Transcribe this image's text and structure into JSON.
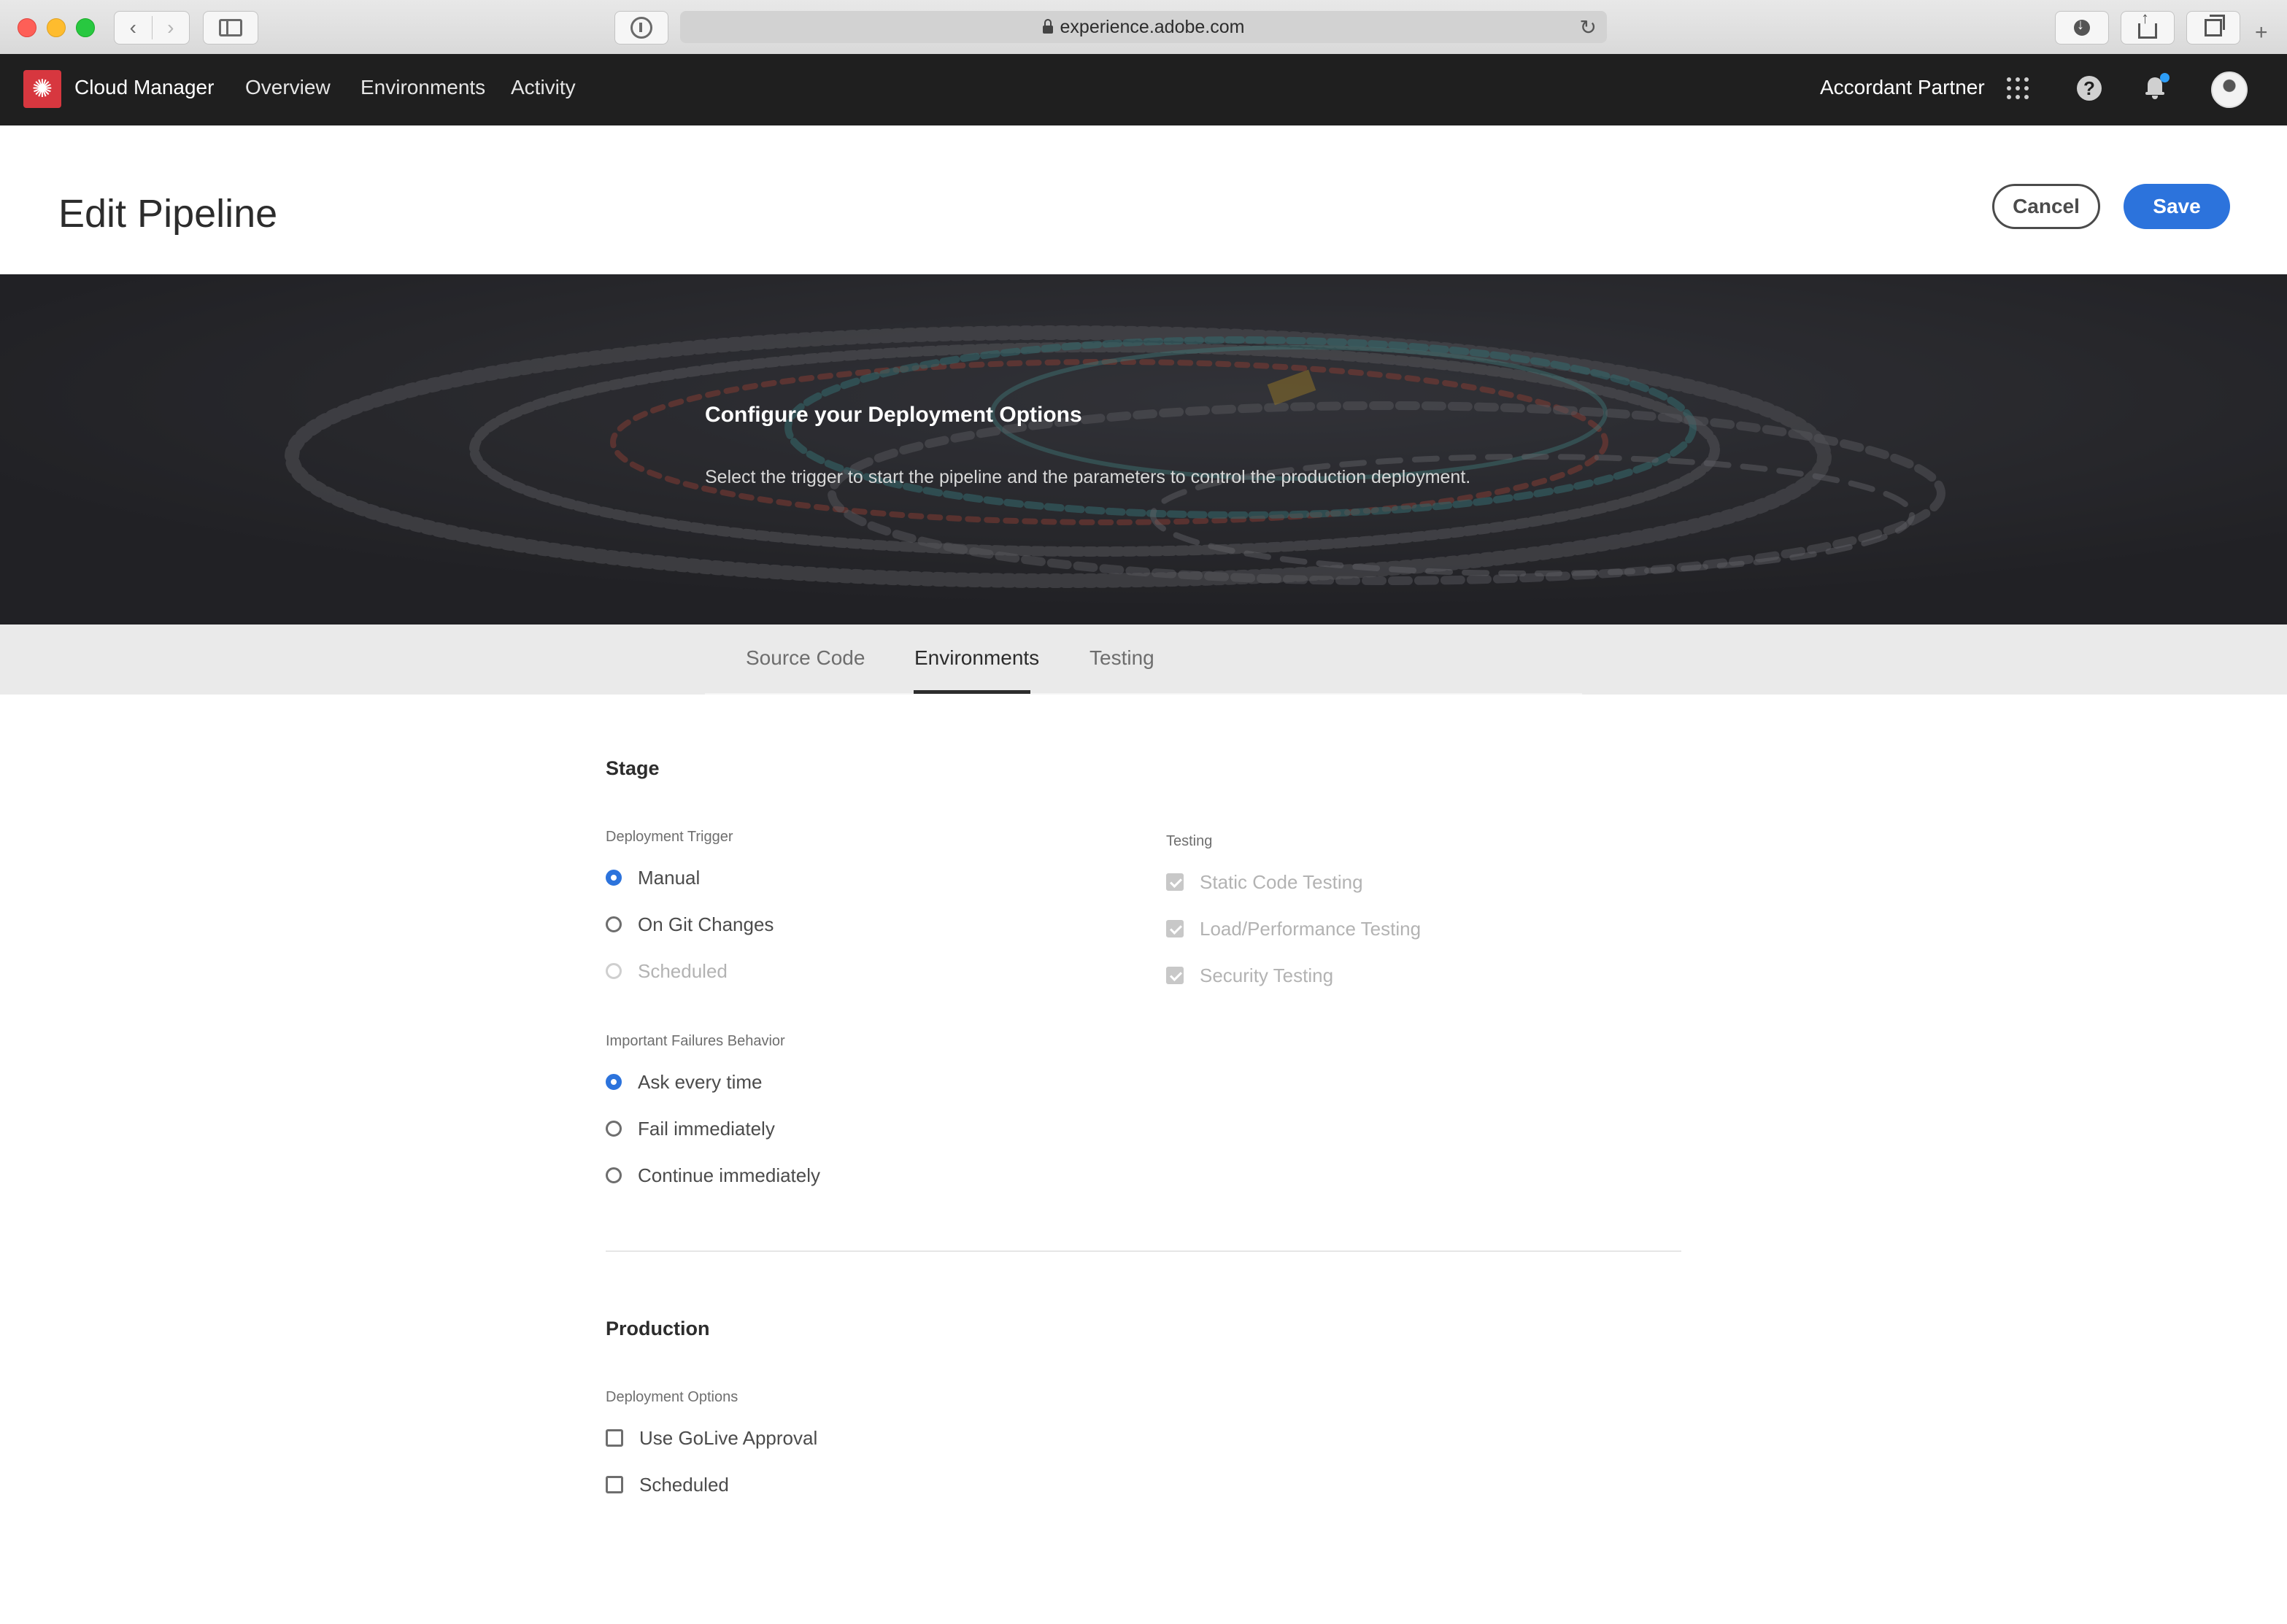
{
  "browser": {
    "url": "experience.adobe.com",
    "back_glyph": "‹",
    "forward_glyph": "›",
    "reload_glyph": "↻",
    "new_tab_glyph": "+"
  },
  "app_nav": {
    "logo_glyph": "✺",
    "app_name": "Cloud Manager",
    "links": [
      "Overview",
      "Environments",
      "Activity"
    ],
    "org_name": "Accordant Partner",
    "help_glyph": "?"
  },
  "header": {
    "title": "Edit Pipeline",
    "cancel_label": "Cancel",
    "save_label": "Save"
  },
  "hero": {
    "title": "Configure your Deployment Options",
    "subtitle": "Select the trigger to start the pipeline and the parameters to control the production deployment."
  },
  "tabs": [
    {
      "label": "Source Code",
      "active": false
    },
    {
      "label": "Environments",
      "active": true
    },
    {
      "label": "Testing",
      "active": false
    }
  ],
  "stage": {
    "title": "Stage",
    "deployment_trigger": {
      "label": "Deployment Trigger",
      "options": [
        {
          "label": "Manual",
          "selected": true,
          "disabled": false
        },
        {
          "label": "On Git Changes",
          "selected": false,
          "disabled": false
        },
        {
          "label": "Scheduled",
          "selected": false,
          "disabled": true
        }
      ]
    },
    "testing": {
      "label": "Testing",
      "options": [
        {
          "label": "Static Code Testing",
          "checked": true,
          "disabled": true
        },
        {
          "label": "Load/Performance Testing",
          "checked": true,
          "disabled": true
        },
        {
          "label": "Security Testing",
          "checked": true,
          "disabled": true
        }
      ]
    },
    "failures_behavior": {
      "label": "Important Failures Behavior",
      "options": [
        {
          "label": "Ask every time",
          "selected": true
        },
        {
          "label": "Fail immediately",
          "selected": false
        },
        {
          "label": "Continue immediately",
          "selected": false
        }
      ]
    }
  },
  "production": {
    "title": "Production",
    "deployment_options": {
      "label": "Deployment Options",
      "options": [
        {
          "label": "Use GoLive Approval",
          "checked": false
        },
        {
          "label": "Scheduled",
          "checked": false
        }
      ]
    }
  },
  "colors": {
    "accent": "#2c73dc",
    "nav_bg": "#1f1f1f",
    "logo_red": "#d7373f",
    "notification_dot": "#2d9df7"
  }
}
